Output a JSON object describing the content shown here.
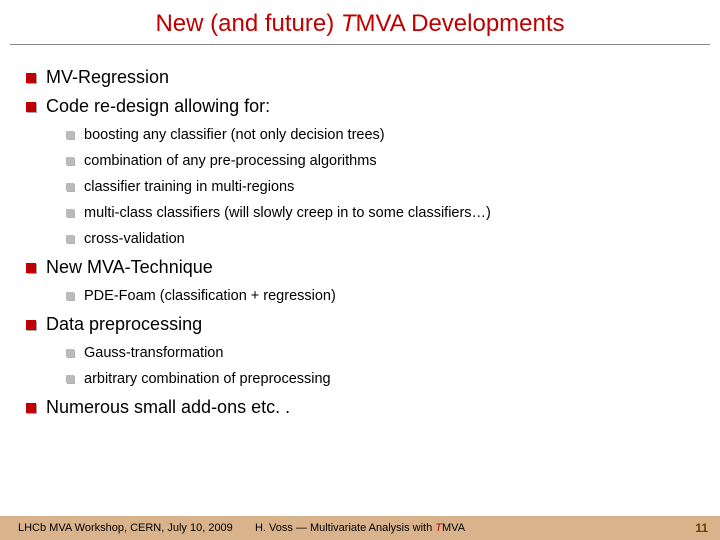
{
  "title": {
    "pre": "New (and future) ",
    "t": "T",
    "post": "MVA Developments"
  },
  "bullets": {
    "b1": "MV-Regression",
    "b2": "Code re-design allowing for:",
    "b2_items": {
      "a": "boosting any classifier (not only decision trees)",
      "b": "combination of any pre-processing algorithms",
      "c": "classifier training in multi-regions",
      "d": "multi-class classifiers (will slowly creep in to some classifiers…)",
      "e": "cross-validation"
    },
    "b3": "New MVA-Technique",
    "b3_items": {
      "a": "PDE-Foam (classification + regression)"
    },
    "b4": "Data preprocessing",
    "b4_items": {
      "a": "Gauss-transformation",
      "b": "arbitrary combination of preprocessing"
    },
    "b5": "Numerous small add-ons etc. ."
  },
  "footer": {
    "left": "LHCb MVA Workshop, CERN, July 10, 2009",
    "center_pre": "H. Voss ― Multivariate Analysis with  ",
    "center_t": "T",
    "center_post": "MVA",
    "right": "11"
  }
}
